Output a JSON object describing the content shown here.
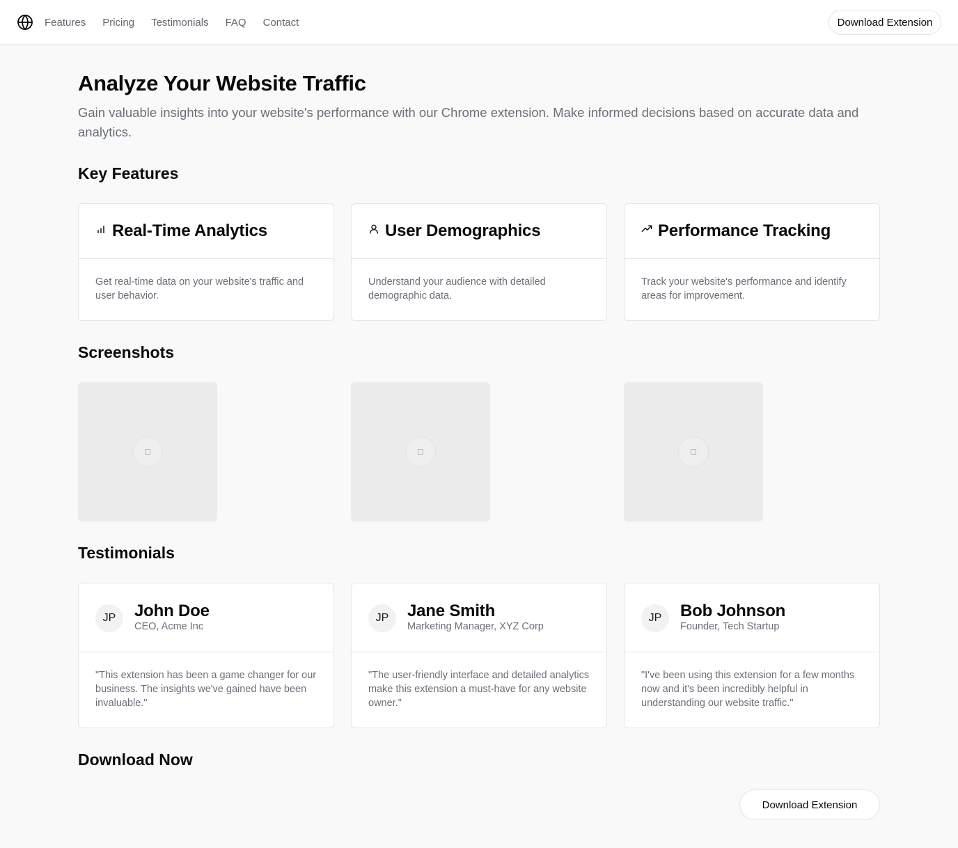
{
  "nav": {
    "logo_icon": "globe-icon",
    "links": [
      "Features",
      "Pricing",
      "Testimonials",
      "FAQ",
      "Contact"
    ],
    "cta_label": "Download Extension"
  },
  "hero": {
    "title": "Analyze Your Website Traffic",
    "subtitle": "Gain valuable insights into your website's performance with our Chrome extension. Make informed decisions based on accurate data and analytics."
  },
  "features": {
    "heading": "Key Features",
    "items": [
      {
        "icon": "bar-chart-icon",
        "title": "Real-Time Analytics",
        "description": "Get real-time data on your website's traffic and user behavior."
      },
      {
        "icon": "user-icon",
        "title": "User Demographics",
        "description": "Understand your audience with detailed demographic data."
      },
      {
        "icon": "trending-up-icon",
        "title": "Performance Tracking",
        "description": "Track your website's performance and identify areas for improvement."
      }
    ]
  },
  "screenshots": {
    "heading": "Screenshots",
    "count": 3
  },
  "testimonials": {
    "heading": "Testimonials",
    "items": [
      {
        "initials": "JP",
        "name": "John Doe",
        "role": "CEO, Acme Inc",
        "quote": "\"This extension has been a game changer for our business. The insights we've gained have been invaluable.\""
      },
      {
        "initials": "JP",
        "name": "Jane Smith",
        "role": "Marketing Manager, XYZ Corp",
        "quote": "\"The user-friendly interface and detailed analytics make this extension a must-have for any website owner.\""
      },
      {
        "initials": "JP",
        "name": "Bob Johnson",
        "role": "Founder, Tech Startup",
        "quote": "\"I've been using this extension for a few months now and it's been incredibly helpful in understanding our website traffic.\""
      }
    ]
  },
  "download": {
    "heading": "Download Now",
    "button_label": "Download Extension"
  }
}
